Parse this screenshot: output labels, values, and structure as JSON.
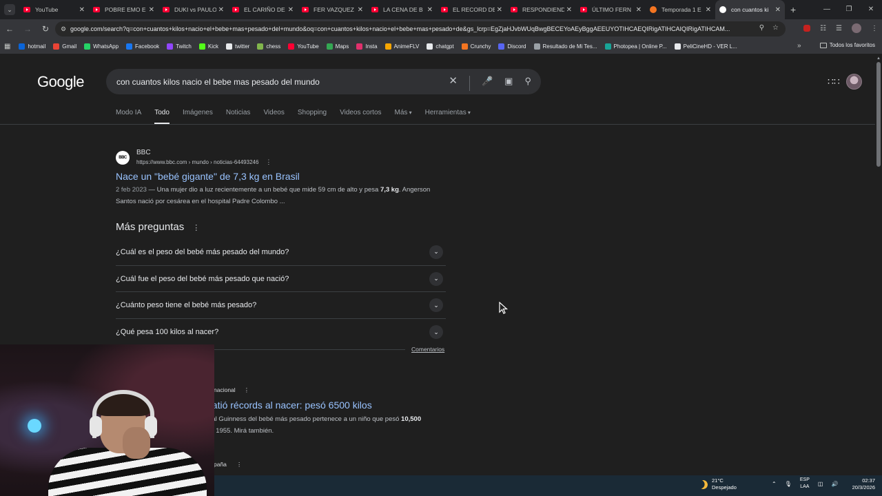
{
  "browser": {
    "tabs": [
      {
        "title": "YouTube",
        "icon": "youtube-icon"
      },
      {
        "title": "POBRE EMO E",
        "icon": "youtube-icon"
      },
      {
        "title": "DUKI vs PAULO",
        "icon": "youtube-icon"
      },
      {
        "title": "EL CARIÑO DE",
        "icon": "youtube-icon"
      },
      {
        "title": "FER VAZQUEZ",
        "icon": "youtube-icon"
      },
      {
        "title": "LA CENA DE B",
        "icon": "youtube-icon"
      },
      {
        "title": "EL RECORD DE",
        "icon": "youtube-icon"
      },
      {
        "title": "RESPONDIEND",
        "icon": "youtube-icon"
      },
      {
        "title": "ÚLTIMO FERN",
        "icon": "youtube-icon"
      },
      {
        "title": "Temporada 1 E",
        "icon": "crunchyroll-icon"
      },
      {
        "title": "con cuantos ki",
        "icon": "google-icon",
        "active": true
      }
    ],
    "new_tab": "+",
    "url": "google.com/search?q=con+cuantos+kilos+nacio+el+bebe+mas+pesado+del+mundo&oq=con+cuantos+kilos+nacio+el+bebe+mas+pesado+de&gs_lcrp=EgZjaHJvbWUqBwgBECEYoAEyBggAEEUYOTIHCAEQIRigATIHCAIQIRigATIHCAM...",
    "bookmarks": [
      {
        "label": "hotmail",
        "color": "#0a64d8"
      },
      {
        "label": "Gmail",
        "color": "#ea4335"
      },
      {
        "label": "WhatsApp",
        "color": "#25d366"
      },
      {
        "label": "Facebook",
        "color": "#1877f2"
      },
      {
        "label": "Twitch",
        "color": "#9146ff"
      },
      {
        "label": "Kick",
        "color": "#53fc18"
      },
      {
        "label": "twitter",
        "color": "#e8eaed"
      },
      {
        "label": "chess",
        "color": "#81b64c"
      },
      {
        "label": "YouTube",
        "color": "#ff0033"
      },
      {
        "label": "Maps",
        "color": "#34a853"
      },
      {
        "label": "Insta",
        "color": "#e1306c"
      },
      {
        "label": "AnimeFLV",
        "color": "#f7a600"
      },
      {
        "label": "chatgpt",
        "color": "#e8eaed"
      },
      {
        "label": "Crunchy",
        "color": "#f47521"
      },
      {
        "label": "Discord",
        "color": "#5865f2"
      },
      {
        "label": "Resultado de Mi Tes...",
        "color": "#9aa0a6"
      },
      {
        "label": "Photopea | Online P...",
        "color": "#18a497"
      },
      {
        "label": "PeliCineHD - VER L...",
        "color": "#e8eaed"
      }
    ],
    "all_bookmarks": "Todos los favoritos"
  },
  "google": {
    "logo": "Google",
    "query": "con cuantos kilos nacio el bebe mas pesado del mundo",
    "tabs": [
      {
        "label": "Modo IA"
      },
      {
        "label": "Todo",
        "selected": true
      },
      {
        "label": "Imágenes"
      },
      {
        "label": "Noticias"
      },
      {
        "label": "Videos"
      },
      {
        "label": "Shopping"
      },
      {
        "label": "Videos cortos"
      },
      {
        "label": "Más",
        "dropdown": true
      },
      {
        "label": "Herramientas",
        "dropdown": true
      }
    ],
    "result1": {
      "favicon_text": "BBC",
      "site": "BBC",
      "url": "https://www.bbc.com › mundo › noticias-64493246",
      "title": "Nace un \"bebé gigante\" de 7,3 kg en Brasil",
      "date": "2 feb 2023",
      "snippet_pre": " — Una mujer dio a luz recientemente a un bebé que mide 59 cm de alto y pesa ",
      "snippet_bold": "7,3 kg",
      "snippet_post": ". Angerson Santos nació por cesárea en el hospital Padre Colombo ..."
    },
    "paa": {
      "title": "Más preguntas",
      "questions": [
        "¿Cuál es el peso del bebé más pesado del mundo?",
        "¿Cuál fue el peso del bebé más pesado que nació?",
        "¿Cuánto peso tiene el bebé más pesado?",
        "¿Qué pesa 100 kilos al nacer?"
      ],
      "feedback": "Comentarios"
    },
    "result2": {
      "source": "nacional",
      "title": "batió récords al nacer: pesó 6500 kilos",
      "snippet_pre": "dial Guinness del bebé más pesado pertenece a un niño que pesó ",
      "snippet_bold": "10,500",
      "snippet_post": "en 1955. Mirá también."
    },
    "result3": {
      "source": "paña"
    }
  },
  "taskbar": {
    "weather_temp": "21°C",
    "weather_desc": "Despejado",
    "lang_1": "ESP",
    "lang_2": "LAA",
    "time": "02:37",
    "date": "20/3/2026"
  }
}
